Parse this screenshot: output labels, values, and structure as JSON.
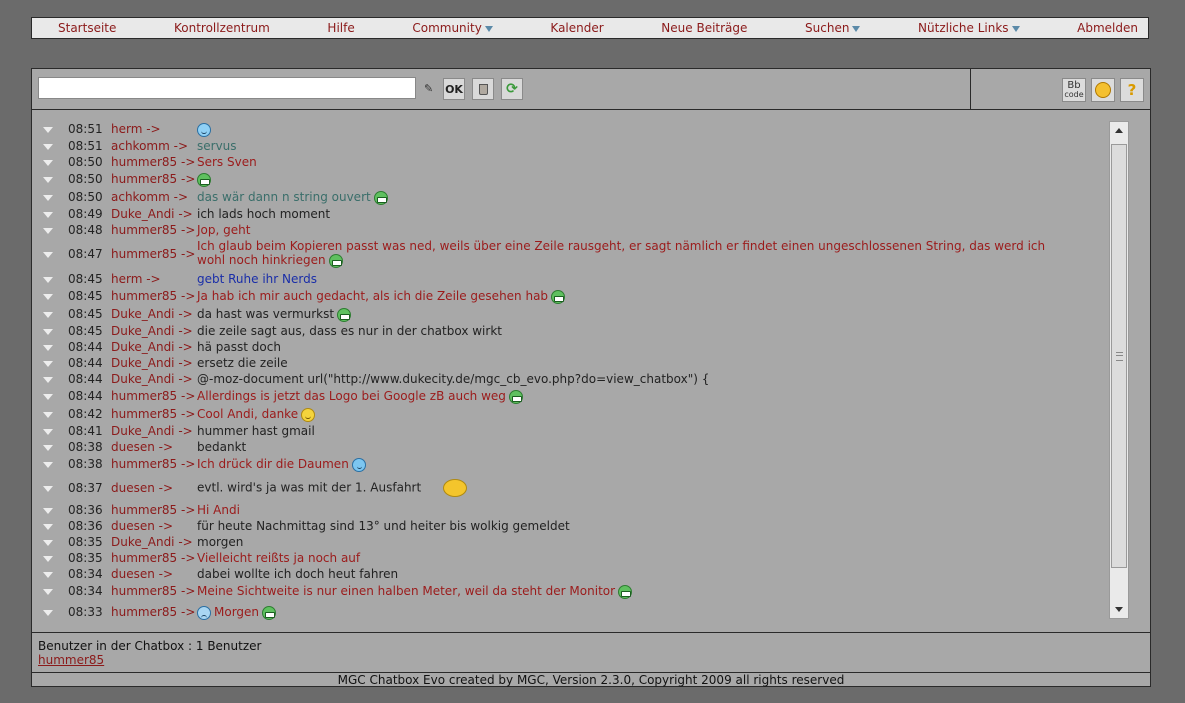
{
  "nav": {
    "items": [
      {
        "label": "Startseite",
        "dropdown": false
      },
      {
        "label": "Kontrollzentrum",
        "dropdown": false
      },
      {
        "label": "Hilfe",
        "dropdown": false
      },
      {
        "label": "Community",
        "dropdown": true
      },
      {
        "label": "Kalender",
        "dropdown": false
      },
      {
        "label": "Neue Beiträge",
        "dropdown": false
      },
      {
        "label": "Suchen",
        "dropdown": true
      },
      {
        "label": "Nützliche Links",
        "dropdown": true
      },
      {
        "label": "Abmelden",
        "dropdown": false
      }
    ]
  },
  "toolbar": {
    "input_value": "",
    "ok_label": "OK",
    "bbcode_line1": "Bb",
    "bbcode_line2": "code",
    "help_label": "?"
  },
  "messages": [
    {
      "time": "08:51",
      "nick": "herm ->",
      "text": "",
      "color": "blue",
      "smiley": "cool"
    },
    {
      "time": "08:51",
      "nick": "achkomm ->",
      "text": "servus",
      "color": "teal",
      "smiley": ""
    },
    {
      "time": "08:50",
      "nick": "hummer85 ->",
      "text": "Sers Sven",
      "color": "red",
      "smiley": ""
    },
    {
      "time": "08:50",
      "nick": "hummer85 ->",
      "text": "",
      "color": "red",
      "smiley": "grin"
    },
    {
      "time": "08:50",
      "nick": "achkomm ->",
      "text": "das wär dann n string ouvert",
      "color": "teal",
      "smiley": "grin"
    },
    {
      "time": "08:49",
      "nick": "Duke_Andi ->",
      "text": "ich lads hoch moment",
      "color": "black",
      "smiley": ""
    },
    {
      "time": "08:48",
      "nick": "hummer85 ->",
      "text": "Jop, geht",
      "color": "red",
      "smiley": ""
    },
    {
      "time": "08:47",
      "nick": "hummer85 ->",
      "text": "Ich glaub beim Kopieren passt was ned, weils über eine Zeile rausgeht, er sagt nämlich er findet einen ungeschlossenen String, das werd ich wohl noch hinkriegen",
      "color": "red",
      "smiley": "grin"
    },
    {
      "time": "08:45",
      "nick": "herm ->",
      "text": "gebt Ruhe ihr Nerds",
      "color": "blue",
      "smiley": ""
    },
    {
      "time": "08:45",
      "nick": "hummer85 ->",
      "text": "Ja hab ich mir auch gedacht, als ich die Zeile gesehen hab",
      "color": "red",
      "smiley": "grin"
    },
    {
      "time": "08:45",
      "nick": "Duke_Andi ->",
      "text": "da hast was vermurkst",
      "color": "black",
      "smiley": "grin"
    },
    {
      "time": "08:45",
      "nick": "Duke_Andi ->",
      "text": "die zeile sagt aus, dass es nur in der chatbox wirkt",
      "color": "black",
      "smiley": ""
    },
    {
      "time": "08:44",
      "nick": "Duke_Andi ->",
      "text": "hä passt doch",
      "color": "black",
      "smiley": ""
    },
    {
      "time": "08:44",
      "nick": "Duke_Andi ->",
      "text": "ersetz die zeile",
      "color": "black",
      "smiley": ""
    },
    {
      "time": "08:44",
      "nick": "Duke_Andi ->",
      "text": "@-moz-document url(\"http://www.dukecity.de/mgc_cb_evo.php?do=view_chatbox\") {",
      "color": "black",
      "smiley": ""
    },
    {
      "time": "08:44",
      "nick": "hummer85 ->",
      "text": "Allerdings is jetzt das Logo bei Google zB auch weg",
      "color": "red",
      "smiley": "grin"
    },
    {
      "time": "08:42",
      "nick": "hummer85 ->",
      "text": "Cool Andi, danke",
      "color": "red",
      "smiley": "yellow"
    },
    {
      "time": "08:41",
      "nick": "Duke_Andi ->",
      "text": "hummer hast gmail",
      "color": "black",
      "smiley": ""
    },
    {
      "time": "08:38",
      "nick": "duesen ->",
      "text": "bedankt",
      "color": "black",
      "smiley": ""
    },
    {
      "time": "08:38",
      "nick": "hummer85 ->",
      "text": "Ich drück dir die Daumen",
      "color": "red",
      "smiley": "wink"
    },
    {
      "time": "08:37",
      "nick": "duesen ->",
      "text": "evtl. wird's ja was mit der 1. Ausfahrt",
      "color": "black",
      "smiley": "wave"
    },
    {
      "time": "08:36",
      "nick": "hummer85 ->",
      "text": "Hi Andi",
      "color": "red",
      "smiley": ""
    },
    {
      "time": "08:36",
      "nick": "duesen ->",
      "text": "für heute Nachmittag sind 13° und heiter bis wolkig gemeldet",
      "color": "black",
      "smiley": ""
    },
    {
      "time": "08:35",
      "nick": "Duke_Andi ->",
      "text": "morgen",
      "color": "black",
      "smiley": ""
    },
    {
      "time": "08:35",
      "nick": "hummer85 ->",
      "text": "Vielleicht reißts ja noch auf",
      "color": "red",
      "smiley": ""
    },
    {
      "time": "08:34",
      "nick": "duesen ->",
      "text": "dabei wollte ich doch heut fahren",
      "color": "black",
      "smiley": ""
    },
    {
      "time": "08:34",
      "nick": "hummer85 ->",
      "text": "Meine Sichtweite is nur einen halben Meter, weil da steht der Monitor",
      "color": "red",
      "smiley": "grin"
    },
    {
      "time": "08:33",
      "nick": "hummer85 ->",
      "text": "Morgen",
      "color": "red",
      "smiley": "sad-lead-grin"
    }
  ],
  "users": {
    "label": "Benutzer in der Chatbox : 1 Benutzer",
    "names": [
      "hummer85"
    ]
  },
  "footer": "MGC Chatbox Evo created by MGC, Version 2.3.0, Copyright 2009 all rights reserved",
  "colors": {
    "page_bg": "#6b6b6b",
    "panel_bg": "#a8a8a8",
    "nick_red": "#8b1a1a",
    "teal": "#3a6e6a",
    "blue": "#1a2ea8"
  }
}
